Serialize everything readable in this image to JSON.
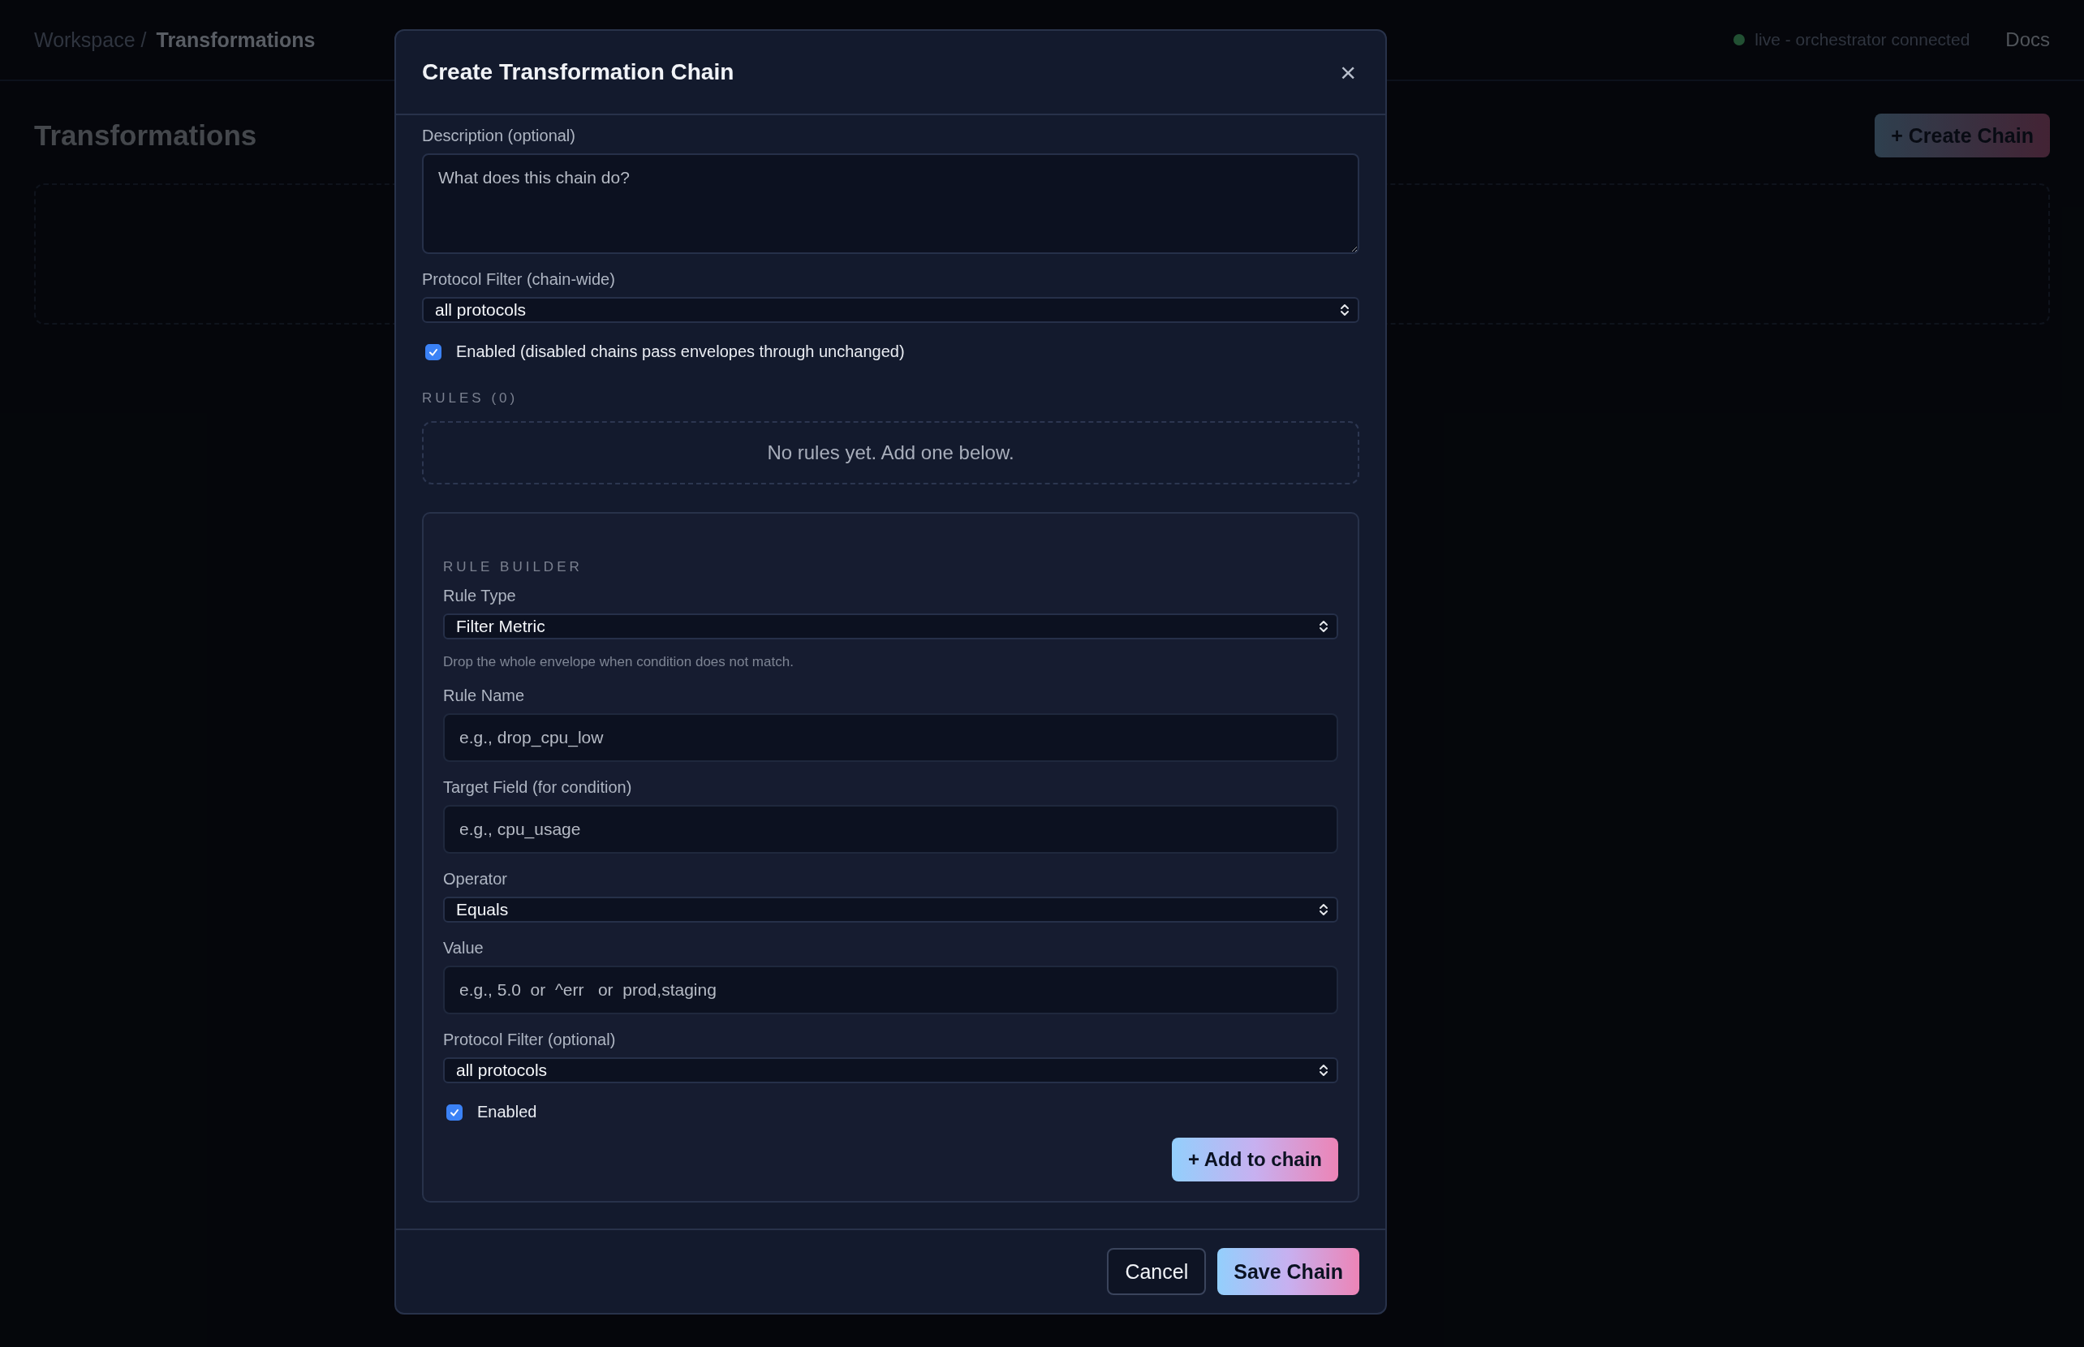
{
  "topbar": {
    "breadcrumb_parent": "Workspace /",
    "breadcrumb_current": "Transformations",
    "status": {
      "text": "live - orchestrator connected",
      "online": true
    },
    "docs_link": "Docs"
  },
  "page": {
    "title": "Transformations",
    "create_button": "+ Create Chain"
  },
  "modal": {
    "title": "Create Transformation Chain",
    "close": "×",
    "fields": [
      {
        "kind": "textarea",
        "label": "Description (optional)",
        "placeholder": "What does this chain do?"
      },
      {
        "kind": "select",
        "label": "Protocol Filter (chain-wide)",
        "value": "all protocols"
      },
      {
        "kind": "checkbox",
        "label": "Enabled (disabled chains pass envelopes through unchanged)",
        "checked": true
      },
      {
        "kind": "heading",
        "text": "RULES (0)"
      },
      {
        "kind": "empty",
        "text": "No rules yet. Add one below."
      }
    ],
    "rule_builder": {
      "heading": "RULE BUILDER",
      "fields": [
        {
          "kind": "select",
          "label": "Rule Type",
          "value": "Filter Metric",
          "help": "Drop the whole envelope when condition does not match."
        },
        {
          "kind": "input",
          "label": "Rule Name",
          "placeholder": "e.g., drop_cpu_low"
        },
        {
          "kind": "input",
          "label": "Target Field (for condition)",
          "placeholder": "e.g., cpu_usage"
        },
        {
          "kind": "select",
          "label": "Operator",
          "value": "Equals"
        },
        {
          "kind": "input",
          "label": "Value",
          "placeholder": "e.g., 5.0  or  ^err   or  prod,staging"
        },
        {
          "kind": "select",
          "label": "Protocol Filter (optional)",
          "value": "all protocols"
        },
        {
          "kind": "checkbox",
          "label": "Enabled",
          "checked": true
        }
      ],
      "add_button": "+ Add to chain"
    },
    "buttons": [
      {
        "label": "Cancel",
        "kind": "secondary"
      },
      {
        "label": "Save Chain",
        "kind": "primary"
      }
    ]
  }
}
